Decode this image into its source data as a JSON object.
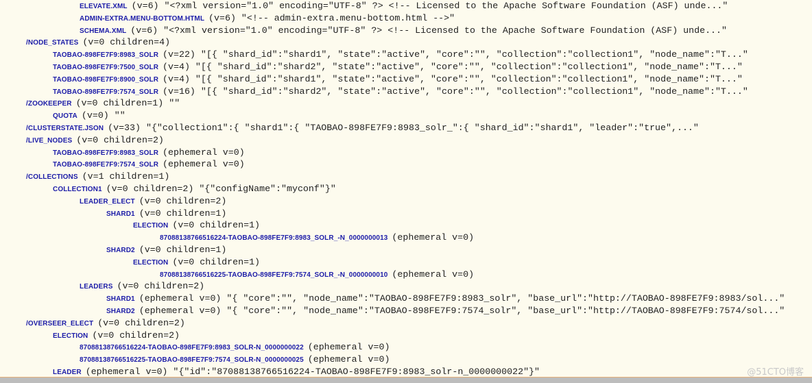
{
  "lines": [
    {
      "level": 2,
      "key": "ELEVATE.XML",
      "rest": "(v=6) \"<?xml version=\"1.0\" encoding=\"UTF-8\" ?> <!-- Licensed to the Apache Software Foundation (ASF) unde...\""
    },
    {
      "level": 2,
      "key": "ADMIN-EXTRA.MENU-BOTTOM.HTML",
      "rest": "(v=6) \"<!-- admin-extra.menu-bottom.html -->\""
    },
    {
      "level": 2,
      "key": "SCHEMA.XML",
      "rest": "(v=6) \"<?xml version=\"1.0\" encoding=\"UTF-8\" ?> <!-- Licensed to the Apache Software Foundation (ASF) unde...\""
    },
    {
      "level": 0,
      "key": "/NODE_STATES",
      "rest": "(v=0 children=4)"
    },
    {
      "level": 1,
      "key": "TAOBAO-898FE7F9:8983_SOLR",
      "rest": "(v=22) \"[{ \"shard_id\":\"shard1\", \"state\":\"active\", \"core\":\"\", \"collection\":\"collection1\", \"node_name\":\"T...\""
    },
    {
      "level": 1,
      "key": "TAOBAO-898FE7F9:7500_SOLR",
      "rest": "(v=4) \"[{ \"shard_id\":\"shard2\", \"state\":\"active\", \"core\":\"\", \"collection\":\"collection1\", \"node_name\":\"T...\""
    },
    {
      "level": 1,
      "key": "TAOBAO-898FE7F9:8900_SOLR",
      "rest": "(v=4) \"[{ \"shard_id\":\"shard1\", \"state\":\"active\", \"core\":\"\", \"collection\":\"collection1\", \"node_name\":\"T...\""
    },
    {
      "level": 1,
      "key": "TAOBAO-898FE7F9:7574_SOLR",
      "rest": "(v=16) \"[{ \"shard_id\":\"shard2\", \"state\":\"active\", \"core\":\"\", \"collection\":\"collection1\", \"node_name\":\"T...\""
    },
    {
      "level": 0,
      "key": "/ZOOKEEPER",
      "rest": "(v=0 children=1) \"\""
    },
    {
      "level": 1,
      "key": "QUOTA",
      "rest": "(v=0) \"\""
    },
    {
      "level": 0,
      "key": "/CLUSTERSTATE.JSON",
      "rest": "(v=33) \"{\"collection1\":{ \"shard1\":{ \"TAOBAO-898FE7F9:8983_solr_\":{ \"shard_id\":\"shard1\", \"leader\":\"true\",...\""
    },
    {
      "level": 0,
      "key": "/LIVE_NODES",
      "rest": "(v=0 children=2)"
    },
    {
      "level": 1,
      "key": "TAOBAO-898FE7F9:8983_SOLR",
      "rest": "(ephemeral v=0)"
    },
    {
      "level": 1,
      "key": "TAOBAO-898FE7F9:7574_SOLR",
      "rest": "(ephemeral v=0)"
    },
    {
      "level": 0,
      "key": "/COLLECTIONS",
      "rest": "(v=1 children=1)"
    },
    {
      "level": 1,
      "key": "COLLECTION1",
      "rest": "(v=0 children=2) \"{\"configName\":\"myconf\"}\""
    },
    {
      "level": 2,
      "key": "LEADER_ELECT",
      "rest": "(v=0 children=2)"
    },
    {
      "level": 3,
      "key": "SHARD1",
      "rest": "(v=0 children=1)"
    },
    {
      "level": 4,
      "key": "ELECTION",
      "rest": "(v=0 children=1)"
    },
    {
      "level": 5,
      "key": "87088138766516224-TAOBAO-898FE7F9:8983_SOLR_-N_0000000013",
      "rest": "(ephemeral v=0)"
    },
    {
      "level": 3,
      "key": "SHARD2",
      "rest": "(v=0 children=1)"
    },
    {
      "level": 4,
      "key": "ELECTION",
      "rest": "(v=0 children=1)"
    },
    {
      "level": 5,
      "key": "87088138766516225-TAOBAO-898FE7F9:7574_SOLR_-N_0000000010",
      "rest": "(ephemeral v=0)"
    },
    {
      "level": 2,
      "key": "LEADERS",
      "rest": "(v=0 children=2)"
    },
    {
      "level": 3,
      "key": "SHARD1",
      "rest": "(ephemeral v=0) \"{ \"core\":\"\", \"node_name\":\"TAOBAO-898FE7F9:8983_solr\", \"base_url\":\"http://TAOBAO-898FE7F9:8983/sol...\""
    },
    {
      "level": 3,
      "key": "SHARD2",
      "rest": "(ephemeral v=0) \"{ \"core\":\"\", \"node_name\":\"TAOBAO-898FE7F9:7574_solr\", \"base_url\":\"http://TAOBAO-898FE7F9:7574/sol...\""
    },
    {
      "level": 0,
      "key": "/OVERSEER_ELECT",
      "rest": "(v=0 children=2)"
    },
    {
      "level": 1,
      "key": "ELECTION",
      "rest": "(v=0 children=2)"
    },
    {
      "level": 2,
      "key": "87088138766516224-TAOBAO-898FE7F9:8983_SOLR-N_0000000022",
      "rest": "(ephemeral v=0)"
    },
    {
      "level": 2,
      "key": "87088138766516225-TAOBAO-898FE7F9:7574_SOLR-N_0000000025",
      "rest": "(ephemeral v=0)"
    },
    {
      "level": 1,
      "key": "LEADER",
      "rest": "(ephemeral v=0) \"{\"id\":\"87088138766516224-TAOBAO-898FE7F9:8983_solr-n_0000000022\"}\""
    }
  ],
  "watermark": "@51CTO博客",
  "colors": {
    "key": "#1c1ca8",
    "text": "#222222",
    "background": "#fdfbee"
  }
}
